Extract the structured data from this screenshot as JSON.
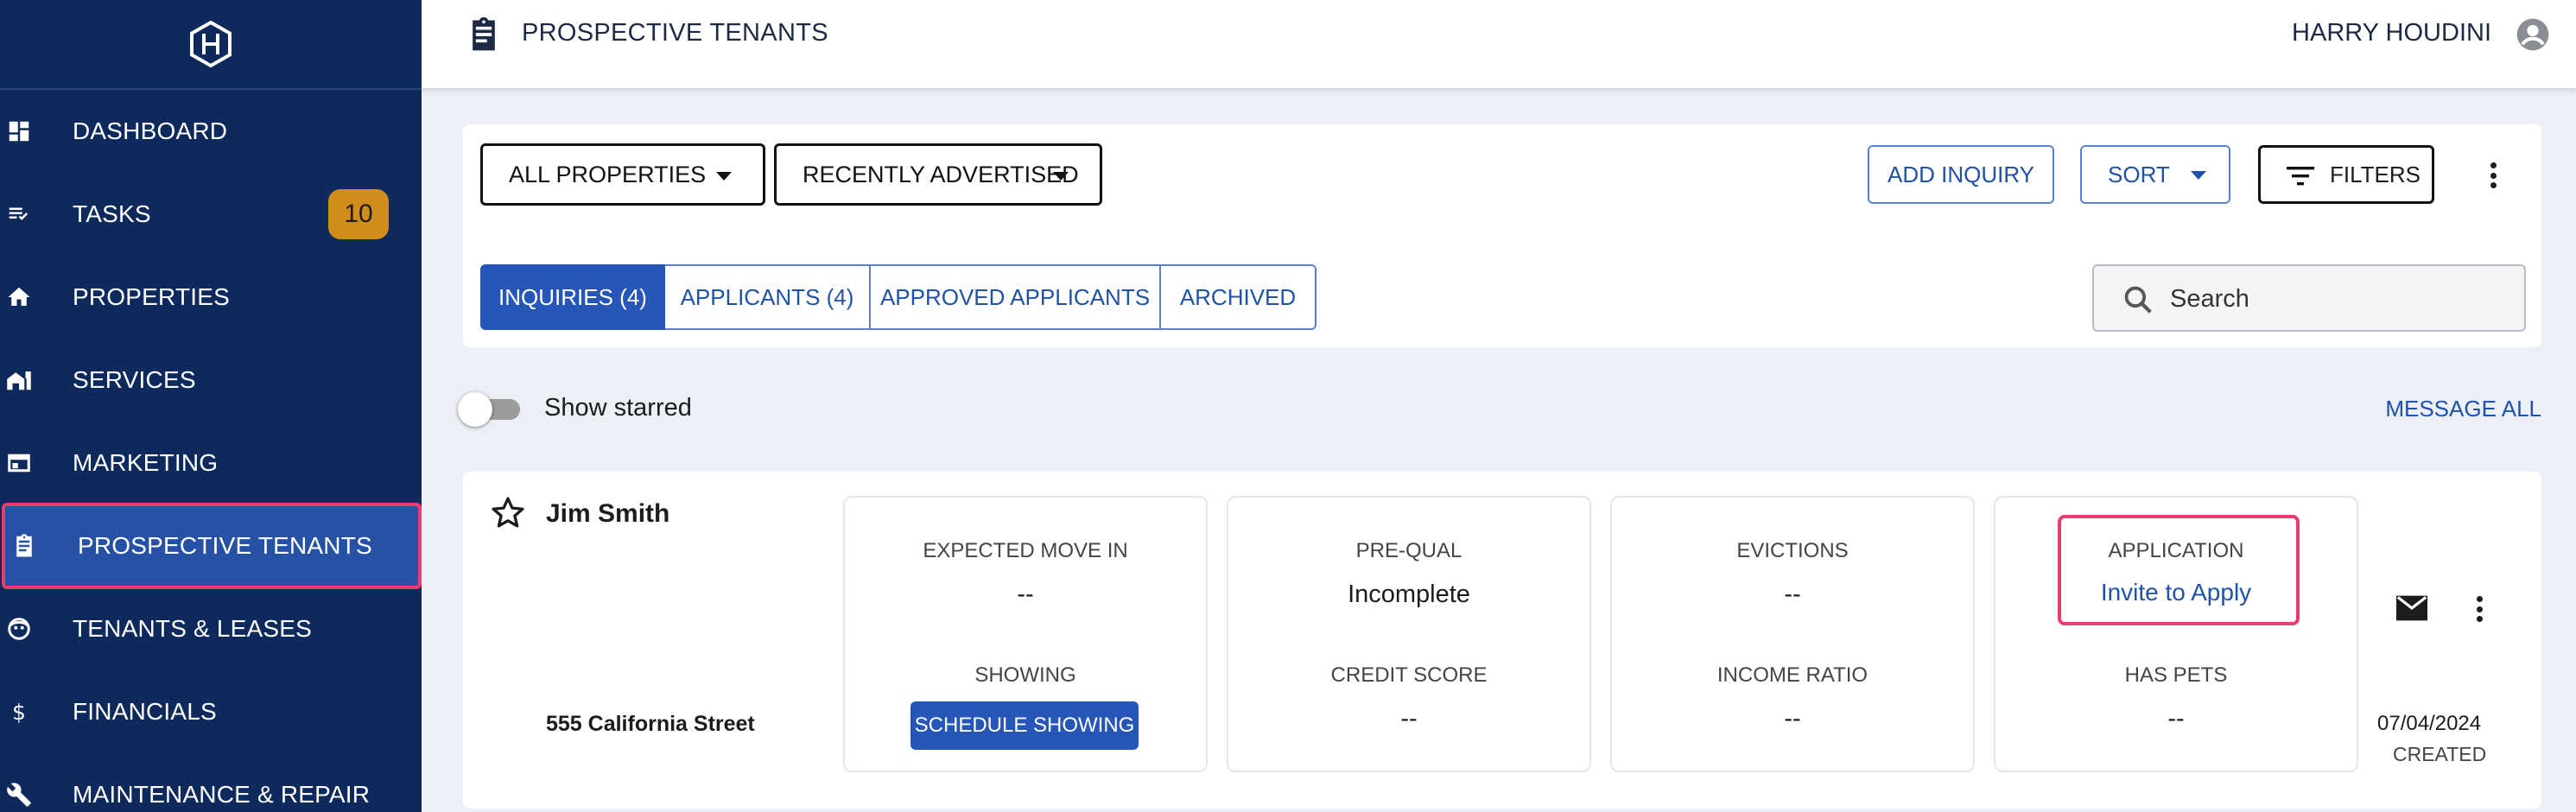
{
  "sidebar": {
    "items": [
      {
        "label": "DASHBOARD",
        "icon": "dashboard-icon"
      },
      {
        "label": "TASKS",
        "icon": "tasks-icon",
        "badge": "10"
      },
      {
        "label": "PROPERTIES",
        "icon": "home-icon"
      },
      {
        "label": "SERVICES",
        "icon": "services-icon"
      },
      {
        "label": "MARKETING",
        "icon": "marketing-icon"
      },
      {
        "label": "PROSPECTIVE TENANTS",
        "icon": "clipboard-icon",
        "active": true
      },
      {
        "label": "TENANTS & LEASES",
        "icon": "tenants-icon"
      },
      {
        "label": "FINANCIALS",
        "icon": "dollar-icon"
      },
      {
        "label": "MAINTENANCE & REPAIR",
        "icon": "wrench-icon"
      }
    ]
  },
  "header": {
    "title": "PROSPECTIVE TENANTS",
    "user_name": "HARRY HOUDINI"
  },
  "toolbar": {
    "property_filter": "ALL PROPERTIES",
    "sort_filter": "RECENTLY ADVERTISED",
    "add_inquiry": "ADD INQUIRY",
    "sort": "SORT",
    "filters": "FILTERS"
  },
  "tabs": [
    {
      "label": "INQUIRIES (4)",
      "active": true
    },
    {
      "label": "APPLICANTS (4)"
    },
    {
      "label": "APPROVED APPLICANTS"
    },
    {
      "label": "ARCHIVED"
    }
  ],
  "search": {
    "placeholder": "Search"
  },
  "starred": {
    "label": "Show starred",
    "on": false
  },
  "message_all": "MESSAGE ALL",
  "tenant": {
    "name": "Jim Smith",
    "address": "555 California Street",
    "expected_move_in_label": "EXPECTED MOVE IN",
    "expected_move_in": "--",
    "showing_label": "SHOWING",
    "schedule_button": "SCHEDULE SHOWING",
    "prequal_label": "PRE-QUAL",
    "prequal": "Incomplete",
    "credit_score_label": "CREDIT SCORE",
    "credit_score": "--",
    "evictions_label": "EVICTIONS",
    "evictions": "--",
    "income_ratio_label": "INCOME RATIO",
    "income_ratio": "--",
    "application_label": "APPLICATION",
    "application_action": "Invite to Apply",
    "has_pets_label": "HAS PETS",
    "has_pets": "--",
    "date": "07/04/2024",
    "date_label": "CREATED"
  },
  "colors": {
    "sidebar_bg": "#0e2a5c",
    "active_nav": "#2751a5",
    "highlight": "#e83e6c",
    "accent_blue": "#2556b8",
    "badge": "#d08d1c"
  }
}
